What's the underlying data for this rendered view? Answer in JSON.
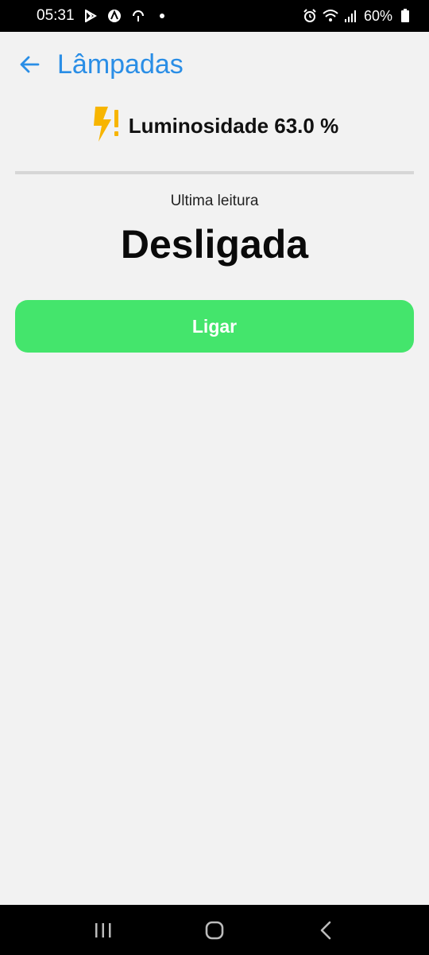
{
  "status_bar": {
    "time": "05:31",
    "battery": "60%",
    "icons": [
      "play-store-icon",
      "app-notification-icon",
      "sync-icon",
      "dot-icon",
      "alarm-icon",
      "wifi-icon",
      "signal-icon",
      "battery-icon"
    ]
  },
  "header": {
    "back_icon": "arrow-left-icon",
    "title": "Lâmpadas"
  },
  "luminosity": {
    "icon": "lightning-alert-icon",
    "text": "Luminosidade 63.0 %"
  },
  "reading": {
    "label": "Ultima leitura",
    "value": "Desligada"
  },
  "action": {
    "label": "Ligar"
  },
  "nav_bar": {
    "icons": [
      "recent-apps-icon",
      "home-icon",
      "back-icon"
    ]
  },
  "colors": {
    "accent": "#2a8ee6",
    "button": "#44e56c",
    "bolt": "#f7b500",
    "background": "#f2f2f2"
  }
}
